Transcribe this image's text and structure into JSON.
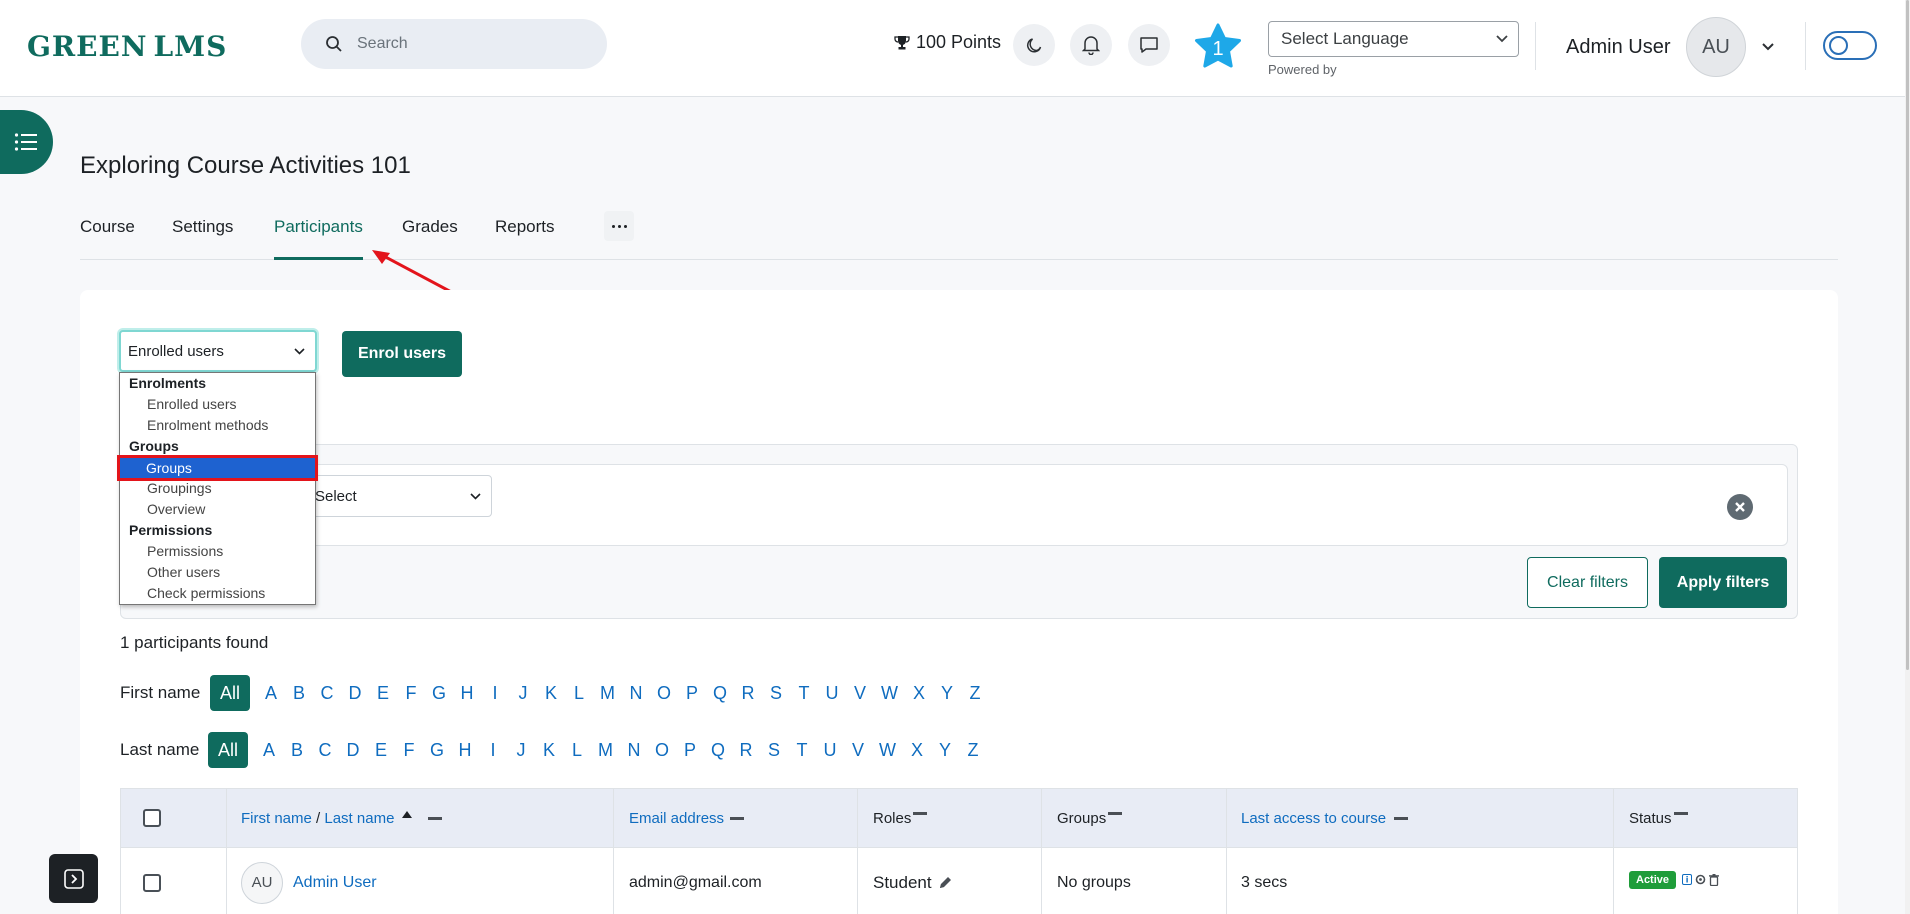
{
  "header": {
    "logo_left": "GREEN",
    "logo_right": "LMS",
    "search_placeholder": "Search",
    "points": "100 Points",
    "notification_count": "1",
    "language_select": "Select Language",
    "powered_by": "Powered by",
    "user_name": "Admin User",
    "user_initials": "AU"
  },
  "course": {
    "title": "Exploring Course Activities 101",
    "tabs": [
      "Course",
      "Settings",
      "Participants",
      "Grades",
      "Reports"
    ],
    "active_tab": "Participants"
  },
  "participants": {
    "page_select": "Enrolled users",
    "enrol_button": "Enrol users",
    "match_select": "Select",
    "clear_filters": "Clear filters",
    "apply_filters": "Apply filters",
    "found_text": "1 participants found",
    "first_name_label": "First name",
    "last_name_label": "Last name",
    "all_label": "All",
    "letters": [
      "A",
      "B",
      "C",
      "D",
      "E",
      "F",
      "G",
      "H",
      "I",
      "J",
      "K",
      "L",
      "M",
      "N",
      "O",
      "P",
      "Q",
      "R",
      "S",
      "T",
      "U",
      "V",
      "W",
      "X",
      "Y",
      "Z"
    ]
  },
  "dropdown": {
    "groups": [
      {
        "label": "Enrolments",
        "options": [
          "Enrolled users",
          "Enrolment methods"
        ]
      },
      {
        "label": "Groups",
        "options": [
          "Groups",
          "Groupings",
          "Overview"
        ]
      },
      {
        "label": "Permissions",
        "options": [
          "Permissions",
          "Other users",
          "Check permissions"
        ]
      }
    ],
    "highlighted": "Groups"
  },
  "table": {
    "headers": {
      "first_name": "First name",
      "slash": " / ",
      "last_name": "Last name",
      "email": "Email address",
      "roles": "Roles",
      "groups": "Groups",
      "last_access": "Last access to course",
      "status": "Status"
    },
    "rows": [
      {
        "initials": "AU",
        "name": "Admin User",
        "email": "admin@gmail.com",
        "role": "Student",
        "groups": "No groups",
        "last_access": "3 secs",
        "status": "Active"
      }
    ]
  },
  "colors": {
    "primary": "#0f6b5e",
    "link": "#0f6cbf",
    "highlight": "#1e62d0",
    "annotation": "#e3141b",
    "status_active": "#1f9d3a"
  }
}
